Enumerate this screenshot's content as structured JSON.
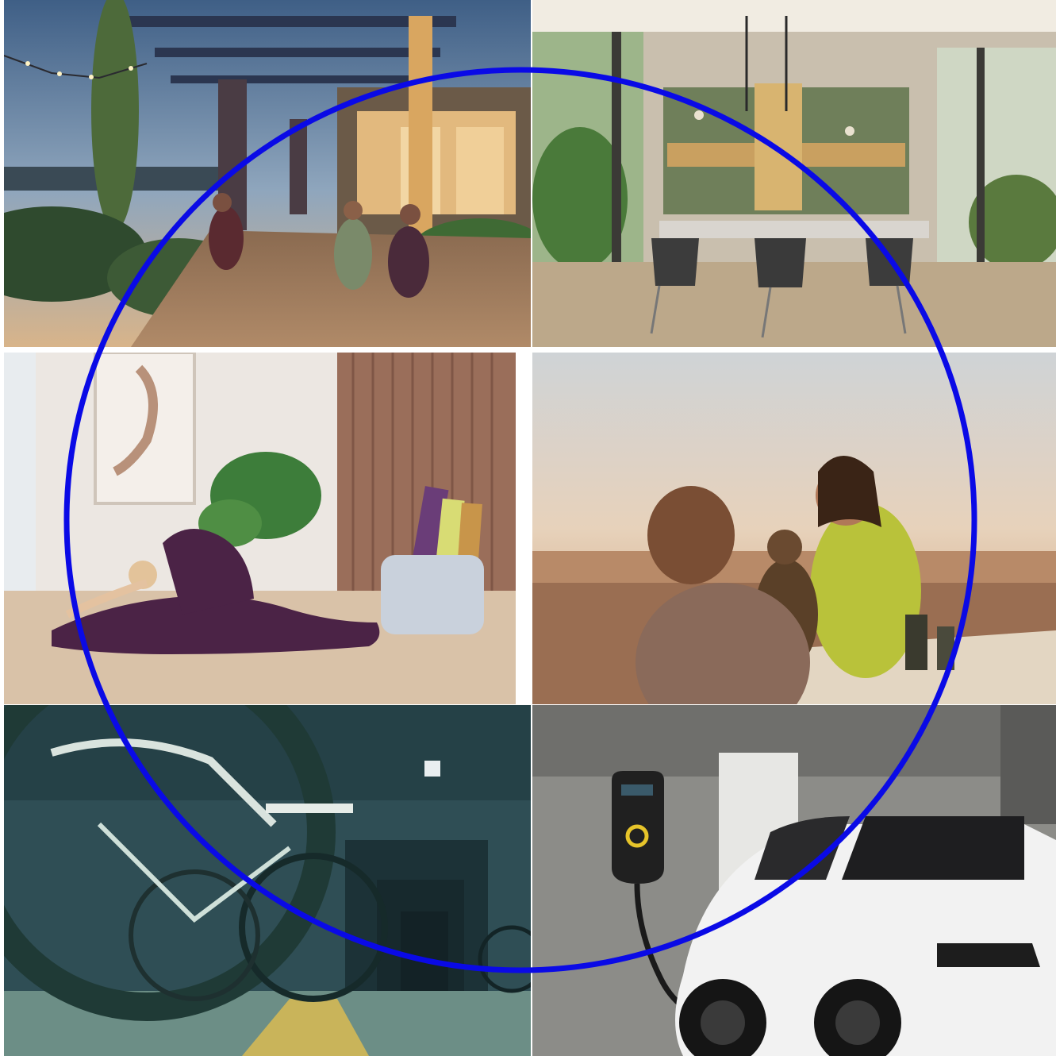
{
  "collage": {
    "tiles": [
      {
        "id": "rooftop-terrace",
        "icon": "rooftop-terrace-photo"
      },
      {
        "id": "dining-room",
        "icon": "dining-room-photo"
      },
      {
        "id": "yoga-studio",
        "icon": "yoga-studio-photo"
      },
      {
        "id": "rooftop-dinner",
        "icon": "rooftop-dinner-photo"
      },
      {
        "id": "bicycle-storage",
        "icon": "bicycle-storage-photo"
      },
      {
        "id": "ev-charging",
        "icon": "ev-charging-photo"
      }
    ]
  },
  "highlight": {
    "shape": "circle",
    "stroke_color": "#0a0ae6"
  }
}
